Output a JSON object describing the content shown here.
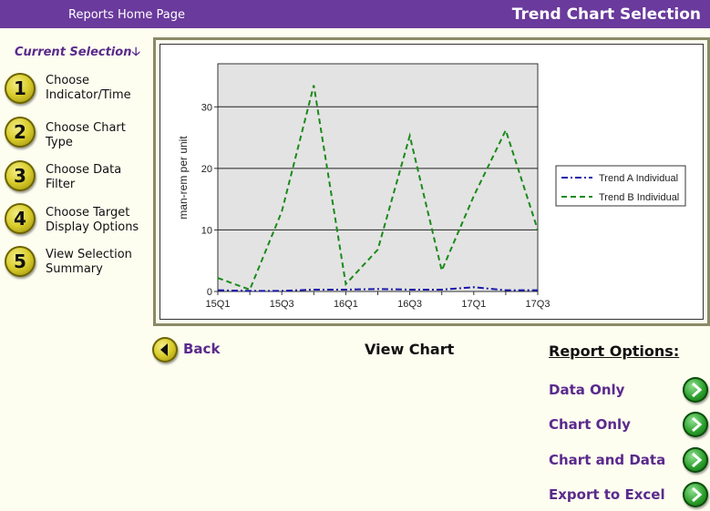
{
  "header": {
    "home_link": "Reports Home Page",
    "page_title": "Trend Chart Selection"
  },
  "sidebar": {
    "current_selection": "Current Selection",
    "steps": [
      {
        "number": "1",
        "label": "Choose Indicator/Time"
      },
      {
        "number": "2",
        "label": "Choose Chart Type"
      },
      {
        "number": "3",
        "label": "Choose Data Filter"
      },
      {
        "number": "4",
        "label": "Choose Target Display Options"
      },
      {
        "number": "5",
        "label": "View Selection Summary"
      }
    ]
  },
  "actions": {
    "back_label": "Back",
    "view_chart_label": "View Chart"
  },
  "report_options": {
    "title": "Report Options:",
    "items": [
      "Data Only",
      "Chart Only",
      "Chart and Data",
      "Export to Excel"
    ]
  },
  "colors": {
    "header_bg": "#6a3a9c",
    "link_purple": "#5a2a8c",
    "series_a": "#1a1aa8",
    "series_b": "#1a8a1a",
    "plot_bg": "#e3e3e3"
  },
  "chart_data": {
    "type": "line",
    "ylabel": "man-rem per unit",
    "xlabel": "",
    "x_ticks": [
      "15Q1",
      "15Q3",
      "16Q1",
      "16Q3",
      "17Q1",
      "17Q3"
    ],
    "x": [
      "15Q1",
      "15Q2",
      "15Q3",
      "15Q4",
      "16Q1",
      "16Q2",
      "16Q3",
      "16Q4",
      "17Q1",
      "17Q2",
      "17Q3"
    ],
    "ylim": [
      0,
      37
    ],
    "y_ticks": [
      0,
      10,
      20,
      30
    ],
    "grid": true,
    "legend_position": "right",
    "series": [
      {
        "name": "Trend A Individual",
        "style": "dash-dot",
        "values": [
          0.2,
          0.1,
          0.1,
          0.3,
          0.3,
          0.4,
          0.3,
          0.3,
          0.7,
          0.2,
          0.2
        ]
      },
      {
        "name": "Trend B Individual",
        "style": "dashed",
        "values": [
          2.2,
          0.3,
          13.0,
          33.5,
          1.2,
          6.8,
          25.3,
          3.4,
          15.5,
          26.2,
          10.0
        ]
      }
    ]
  }
}
